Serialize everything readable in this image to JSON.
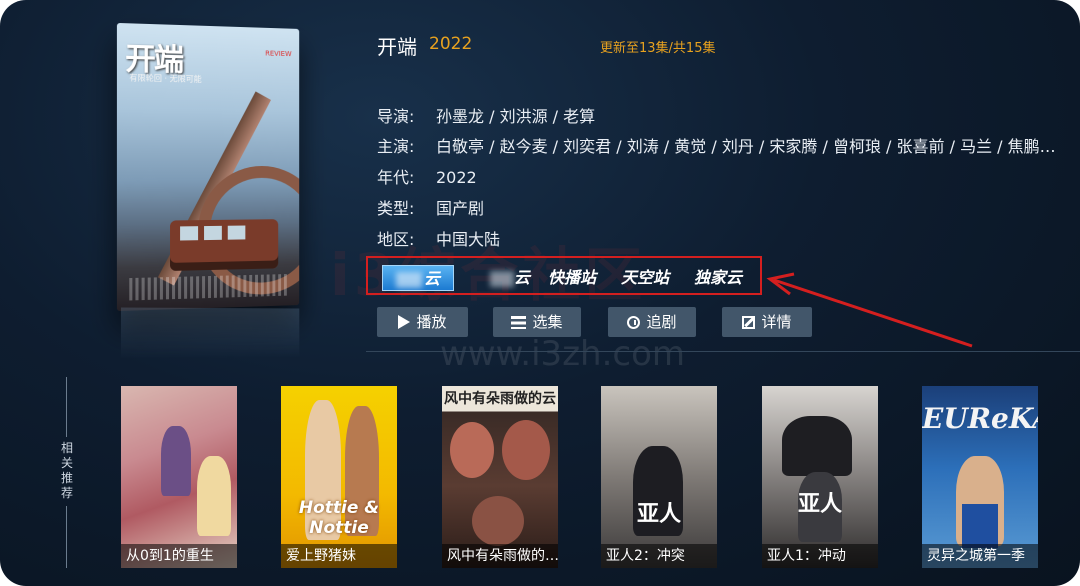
{
  "title": "开端",
  "year": "2022",
  "update_status": "更新至13集/共15集",
  "info": {
    "director_label": "导演:",
    "director": "孙墨龙 / 刘洪源 / 老算",
    "cast_label": "主演:",
    "cast": "白敬亭 / 赵今麦 / 刘奕君 / 刘涛 / 黄觉 / 刘丹 / 宋家腾 / 曾柯琅 / 张喜前 / 马兰 / 焦鹏…",
    "year_label": "年代:",
    "year": "2022",
    "type_label": "类型:",
    "type": "国产剧",
    "region_label": "地区:",
    "region": "中国大陆"
  },
  "sources": [
    {
      "label": "云",
      "selected": true
    },
    {
      "label": "云",
      "selected": false
    },
    {
      "label": "快播站",
      "selected": false
    },
    {
      "label": "天空站",
      "selected": false
    },
    {
      "label": "独家云",
      "selected": false
    }
  ],
  "actions": {
    "play": "播放",
    "episodes": "选集",
    "follow": "追剧",
    "detail": "详情"
  },
  "poster": {
    "title": "开端",
    "tagline": "有限轮回 · 无限可能",
    "small_text": "REVIEW"
  },
  "watermark": {
    "main": "i3综合社区",
    "url": "www.i3zh.com"
  },
  "side_label": "相关推荐",
  "recommendations": [
    {
      "caption": "从0到1的重生",
      "poster_text": ""
    },
    {
      "caption": "爱上野猪妹",
      "poster_text": "Hottie & Nottie"
    },
    {
      "caption": "风中有朵雨做的…",
      "poster_text": "风中有朵雨做的云"
    },
    {
      "caption": "亚人2：冲突",
      "poster_text": "亚人"
    },
    {
      "caption": "亚人1：冲动",
      "poster_text": "亚人"
    },
    {
      "caption": "灵异之城第一季",
      "poster_text": "EUReKA"
    }
  ],
  "colors": {
    "accent": "#e8a21f",
    "highlight_box": "#d41f1f",
    "selected_source": "#2b8ae0",
    "button_bg": "#42566a"
  }
}
